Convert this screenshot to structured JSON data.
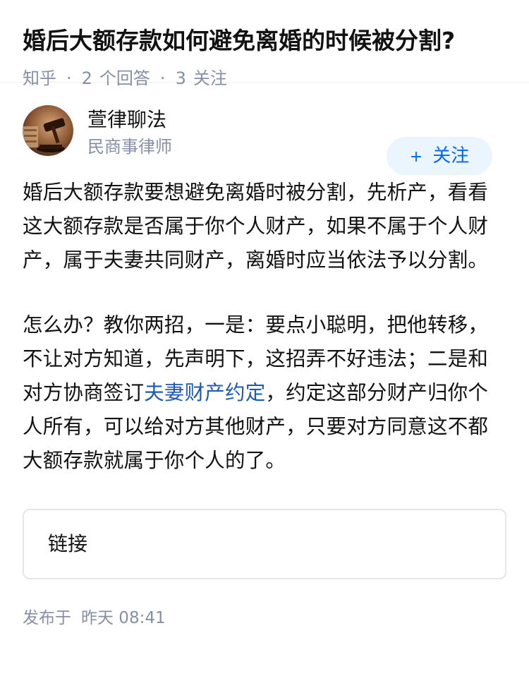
{
  "question": {
    "title": "婚后大额存款如何避免离婚的时候被分割?",
    "source": "知乎",
    "answers_count": "2",
    "answers_label": "个回答",
    "followers_count": "3",
    "followers_label": "关注"
  },
  "author": {
    "name": "萱律聊法",
    "title": "民商事律师",
    "follow_icon": "+",
    "follow_label": "关注"
  },
  "answer": {
    "paragraph1": "婚后大额存款要想避免离婚时被分割，先析产，看看这大额存款是否属于你个人财产，如果不属于个人财产，属于夫妻共同财产，离婚时应当依法予以分割。",
    "paragraph2_before": "怎么办？教你两招，一是：要点小聪明，把他转移，不让对方知道，先声明下，这招弄不好违法；二是和对方协商签订",
    "paragraph2_link": "夫妻财产约定",
    "paragraph2_after": "，约定这部分财产归你个人所有，可以给对方其他财产，只要对方同意这不都大额存款就属于你个人的了。"
  },
  "link_card": {
    "label": "链接"
  },
  "publish": {
    "label": "发布于",
    "time": "昨天 08:41"
  },
  "colors": {
    "accent": "#0066ff",
    "link": "#1e5ab4",
    "meta_gray": "#8590a6",
    "follow_bg": "#ebf5fd"
  }
}
